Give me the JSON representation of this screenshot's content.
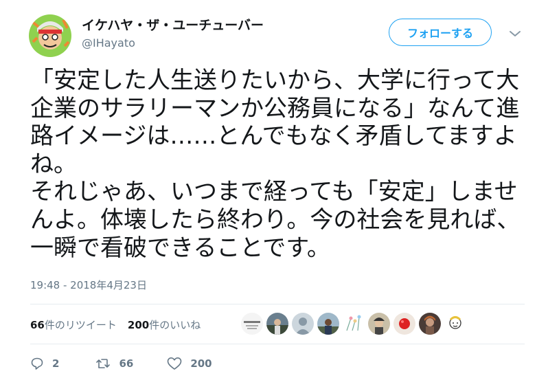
{
  "author": {
    "display_name": "イケハヤ・ザ・ユーチューバー",
    "handle": "@IHayato"
  },
  "follow_button": {
    "label": "フォローする"
  },
  "tweet": {
    "text": "「安定した人生送りたいから、大学に行って大企業のサラリーマンか公務員になる」なんて進路イメージは……とんでもなく矛盾してますよね。\nそれじゃあ、いつまで経っても「安定」しませんよ。体壊したら終わり。今の社会を見れば、一瞬で看破できることです。",
    "timestamp": "19:48 - 2018年4月23日"
  },
  "stats": {
    "retweets_count": "66",
    "retweets_label": "件のリツイート",
    "likes_count": "200",
    "likes_label": "件のいいね"
  },
  "actions": {
    "reply_count": "2",
    "retweet_count": "66",
    "like_count": "200"
  },
  "colors": {
    "accent": "#1da1f2",
    "secondary_text": "#657786",
    "divider": "#e6ecf0"
  },
  "liker_avatars": [
    {
      "icon": "avatar-card"
    },
    {
      "icon": "avatar-person-landscape"
    },
    {
      "icon": "avatar-default-silhouette"
    },
    {
      "icon": "avatar-person-outdoor"
    },
    {
      "icon": "avatar-sketch-flowers"
    },
    {
      "icon": "avatar-person-hat"
    },
    {
      "icon": "avatar-red-object"
    },
    {
      "icon": "avatar-person-dark"
    },
    {
      "icon": "avatar-sketch-face"
    }
  ]
}
